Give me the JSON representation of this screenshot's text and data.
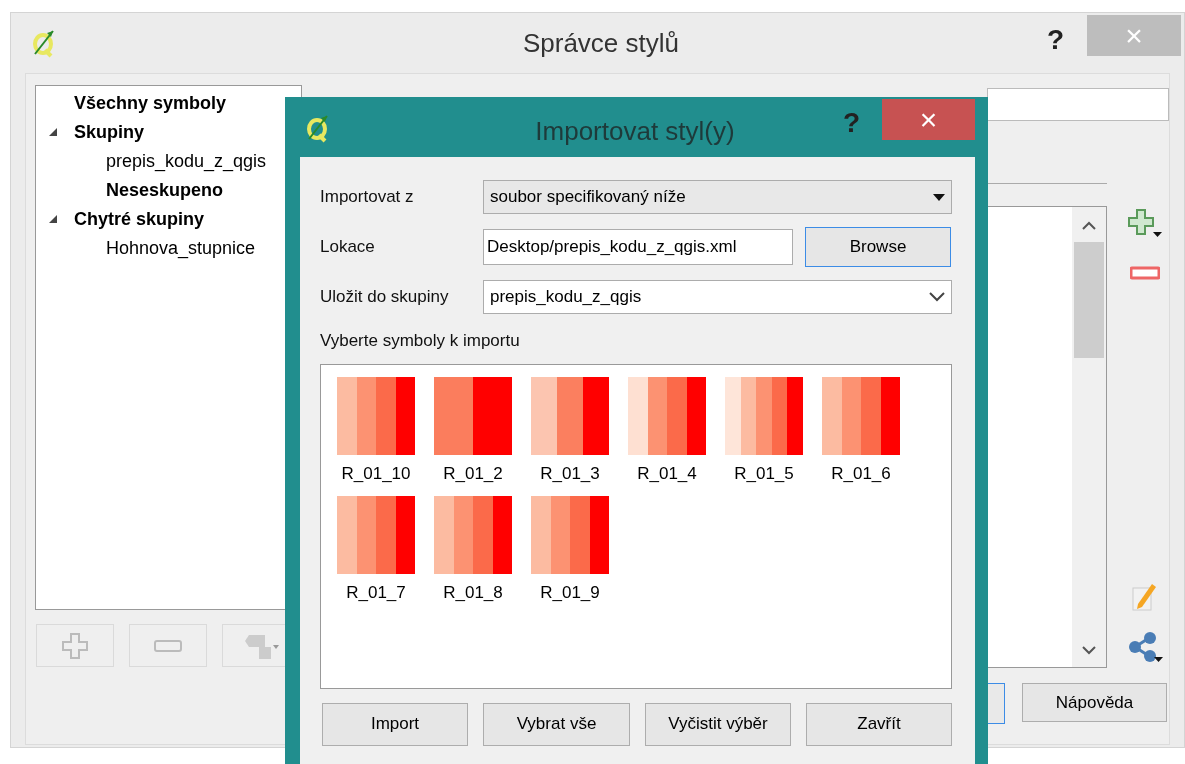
{
  "window": {
    "title": "Správce stylů",
    "help": "?",
    "close": "×"
  },
  "tree": [
    {
      "label": "Všechny symboly",
      "bold": true
    },
    {
      "label": "Skupiny",
      "bold": true,
      "expanded": true,
      "children": [
        {
          "label": "prepis_kodu_z_qgis",
          "bold": false
        },
        {
          "label": "Neseskupeno",
          "bold": true
        }
      ]
    },
    {
      "label": "Chytré skupiny",
      "bold": true,
      "expanded": true,
      "children": [
        {
          "label": "Hohnova_stupnice",
          "bold": false
        }
      ]
    }
  ],
  "buttons": [
    "Nápověda"
  ],
  "dialog": {
    "title": "Importovat styl(y)",
    "help": "?",
    "close": "×",
    "fields": [
      {
        "kind": "combo",
        "label": "Importovat z",
        "value": "soubor specifikovaný níže"
      },
      {
        "kind": "file",
        "label": "Lokace",
        "value": "Desktop/prepis_kodu_z_qgis.xml",
        "button": "Browse"
      },
      {
        "kind": "editcombo",
        "label": "Uložit do skupiny",
        "value": "prepis_kodu_z_qgis"
      }
    ],
    "list_label": "Vyberte symboly k importu",
    "symbols": [
      {
        "name": "R_01_10",
        "stripes": [
          {
            "color": "#fcbba1"
          },
          {
            "color": "#fc9272"
          },
          {
            "color": "#fb6a4a"
          },
          {
            "color": "#ff0000"
          }
        ]
      },
      {
        "name": "R_01_2",
        "stripes": [
          {
            "color": "#fb7d5d"
          },
          {
            "color": "#ff0000"
          }
        ]
      },
      {
        "name": "R_01_3",
        "stripes": [
          {
            "color": "#fcc5b0"
          },
          {
            "color": "#fb7f5f"
          },
          {
            "color": "#ff0000"
          }
        ]
      },
      {
        "name": "R_01_4",
        "stripes": [
          {
            "color": "#fee0d2"
          },
          {
            "color": "#fc9272"
          },
          {
            "color": "#fb6a4a"
          },
          {
            "color": "#ff0000"
          }
        ]
      },
      {
        "name": "R_01_5",
        "stripes": [
          {
            "color": "#fee5d9"
          },
          {
            "color": "#fcbba1"
          },
          {
            "color": "#fc9272"
          },
          {
            "color": "#fb6a4a"
          },
          {
            "color": "#ff0000"
          }
        ]
      },
      {
        "name": "R_01_6",
        "stripes": [
          {
            "color": "#fcbba1"
          },
          {
            "color": "#fc9272"
          },
          {
            "color": "#fb6a4a"
          },
          {
            "color": "#ff0000"
          }
        ]
      },
      {
        "name": "R_01_7",
        "stripes": [
          {
            "color": "#fcbba1"
          },
          {
            "color": "#fc9272"
          },
          {
            "color": "#fb6a4a"
          },
          {
            "color": "#ff0000"
          }
        ]
      },
      {
        "name": "R_01_8",
        "stripes": [
          {
            "color": "#fcbba1"
          },
          {
            "color": "#fc9272"
          },
          {
            "color": "#fb6a4a"
          },
          {
            "color": "#ff0000"
          }
        ]
      },
      {
        "name": "R_01_9",
        "stripes": [
          {
            "color": "#fcbba1"
          },
          {
            "color": "#fc9272"
          },
          {
            "color": "#fb6a4a"
          },
          {
            "color": "#ff0000"
          }
        ]
      }
    ],
    "buttons": [
      "Import",
      "Vybrat vše",
      "Vyčistit výběr",
      "Zavřít"
    ]
  }
}
